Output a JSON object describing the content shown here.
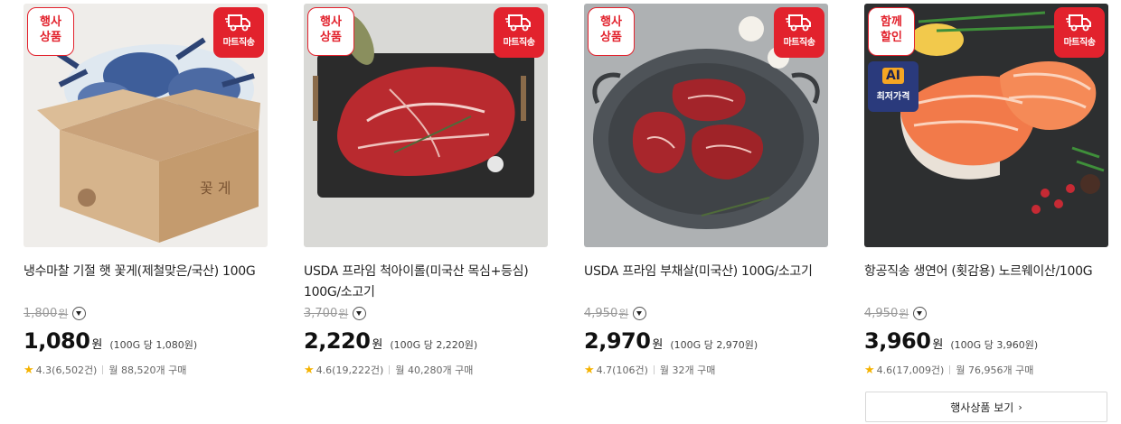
{
  "badges": {
    "event_line1": "행사",
    "event_line2": "상품",
    "combo_line1": "함께",
    "combo_line2": "할인",
    "mart_delivery": "마트직송",
    "ai_label": "AI",
    "ai_lowest": "최저가격"
  },
  "products": [
    {
      "title": "냉수마찰 기절 햇 꽃게(제철맞은/국산) 100G",
      "orig_price": "1,800",
      "orig_won": "원",
      "price": "1,080",
      "won": "원",
      "unit_price": "(100G 당 1,080원)",
      "rating": "4.3",
      "reviews": "(6,502건)",
      "monthly": "월 88,520개 구매",
      "image": "blue-crabs-in-box"
    },
    {
      "title": "USDA 프라임 척아이롤(미국산 목심+등심) 100G/소고기",
      "orig_price": "3,700",
      "orig_won": "원",
      "price": "2,220",
      "won": "원",
      "unit_price": "(100G 당 2,220원)",
      "rating": "4.6",
      "reviews": "(19,222건)",
      "monthly": "월 40,280개 구매",
      "image": "beef-chuck-on-slate"
    },
    {
      "title": "USDA 프라임 부채살(미국산) 100G/소고기",
      "orig_price": "4,950",
      "orig_won": "원",
      "price": "2,970",
      "won": "원",
      "unit_price": "(100G 당 2,970원)",
      "rating": "4.7",
      "reviews": "(106건)",
      "monthly": "월 32개 구매",
      "image": "beef-steaks-on-tray"
    },
    {
      "title": "항공직송 생연어 (횟감용) 노르웨이산/100G",
      "orig_price": "4,950",
      "orig_won": "원",
      "price": "3,960",
      "won": "원",
      "unit_price": "(100G 당 3,960원)",
      "rating": "4.6",
      "reviews": "(17,009건)",
      "monthly": "월 76,956개 구매",
      "image": "salmon-fillets"
    }
  ],
  "more_button": {
    "label": "행사상품 보기",
    "chevron": "›"
  },
  "colors": {
    "accent_red": "#e2222d",
    "star": "#f5b301",
    "ai_navy": "#2a3a7c"
  }
}
